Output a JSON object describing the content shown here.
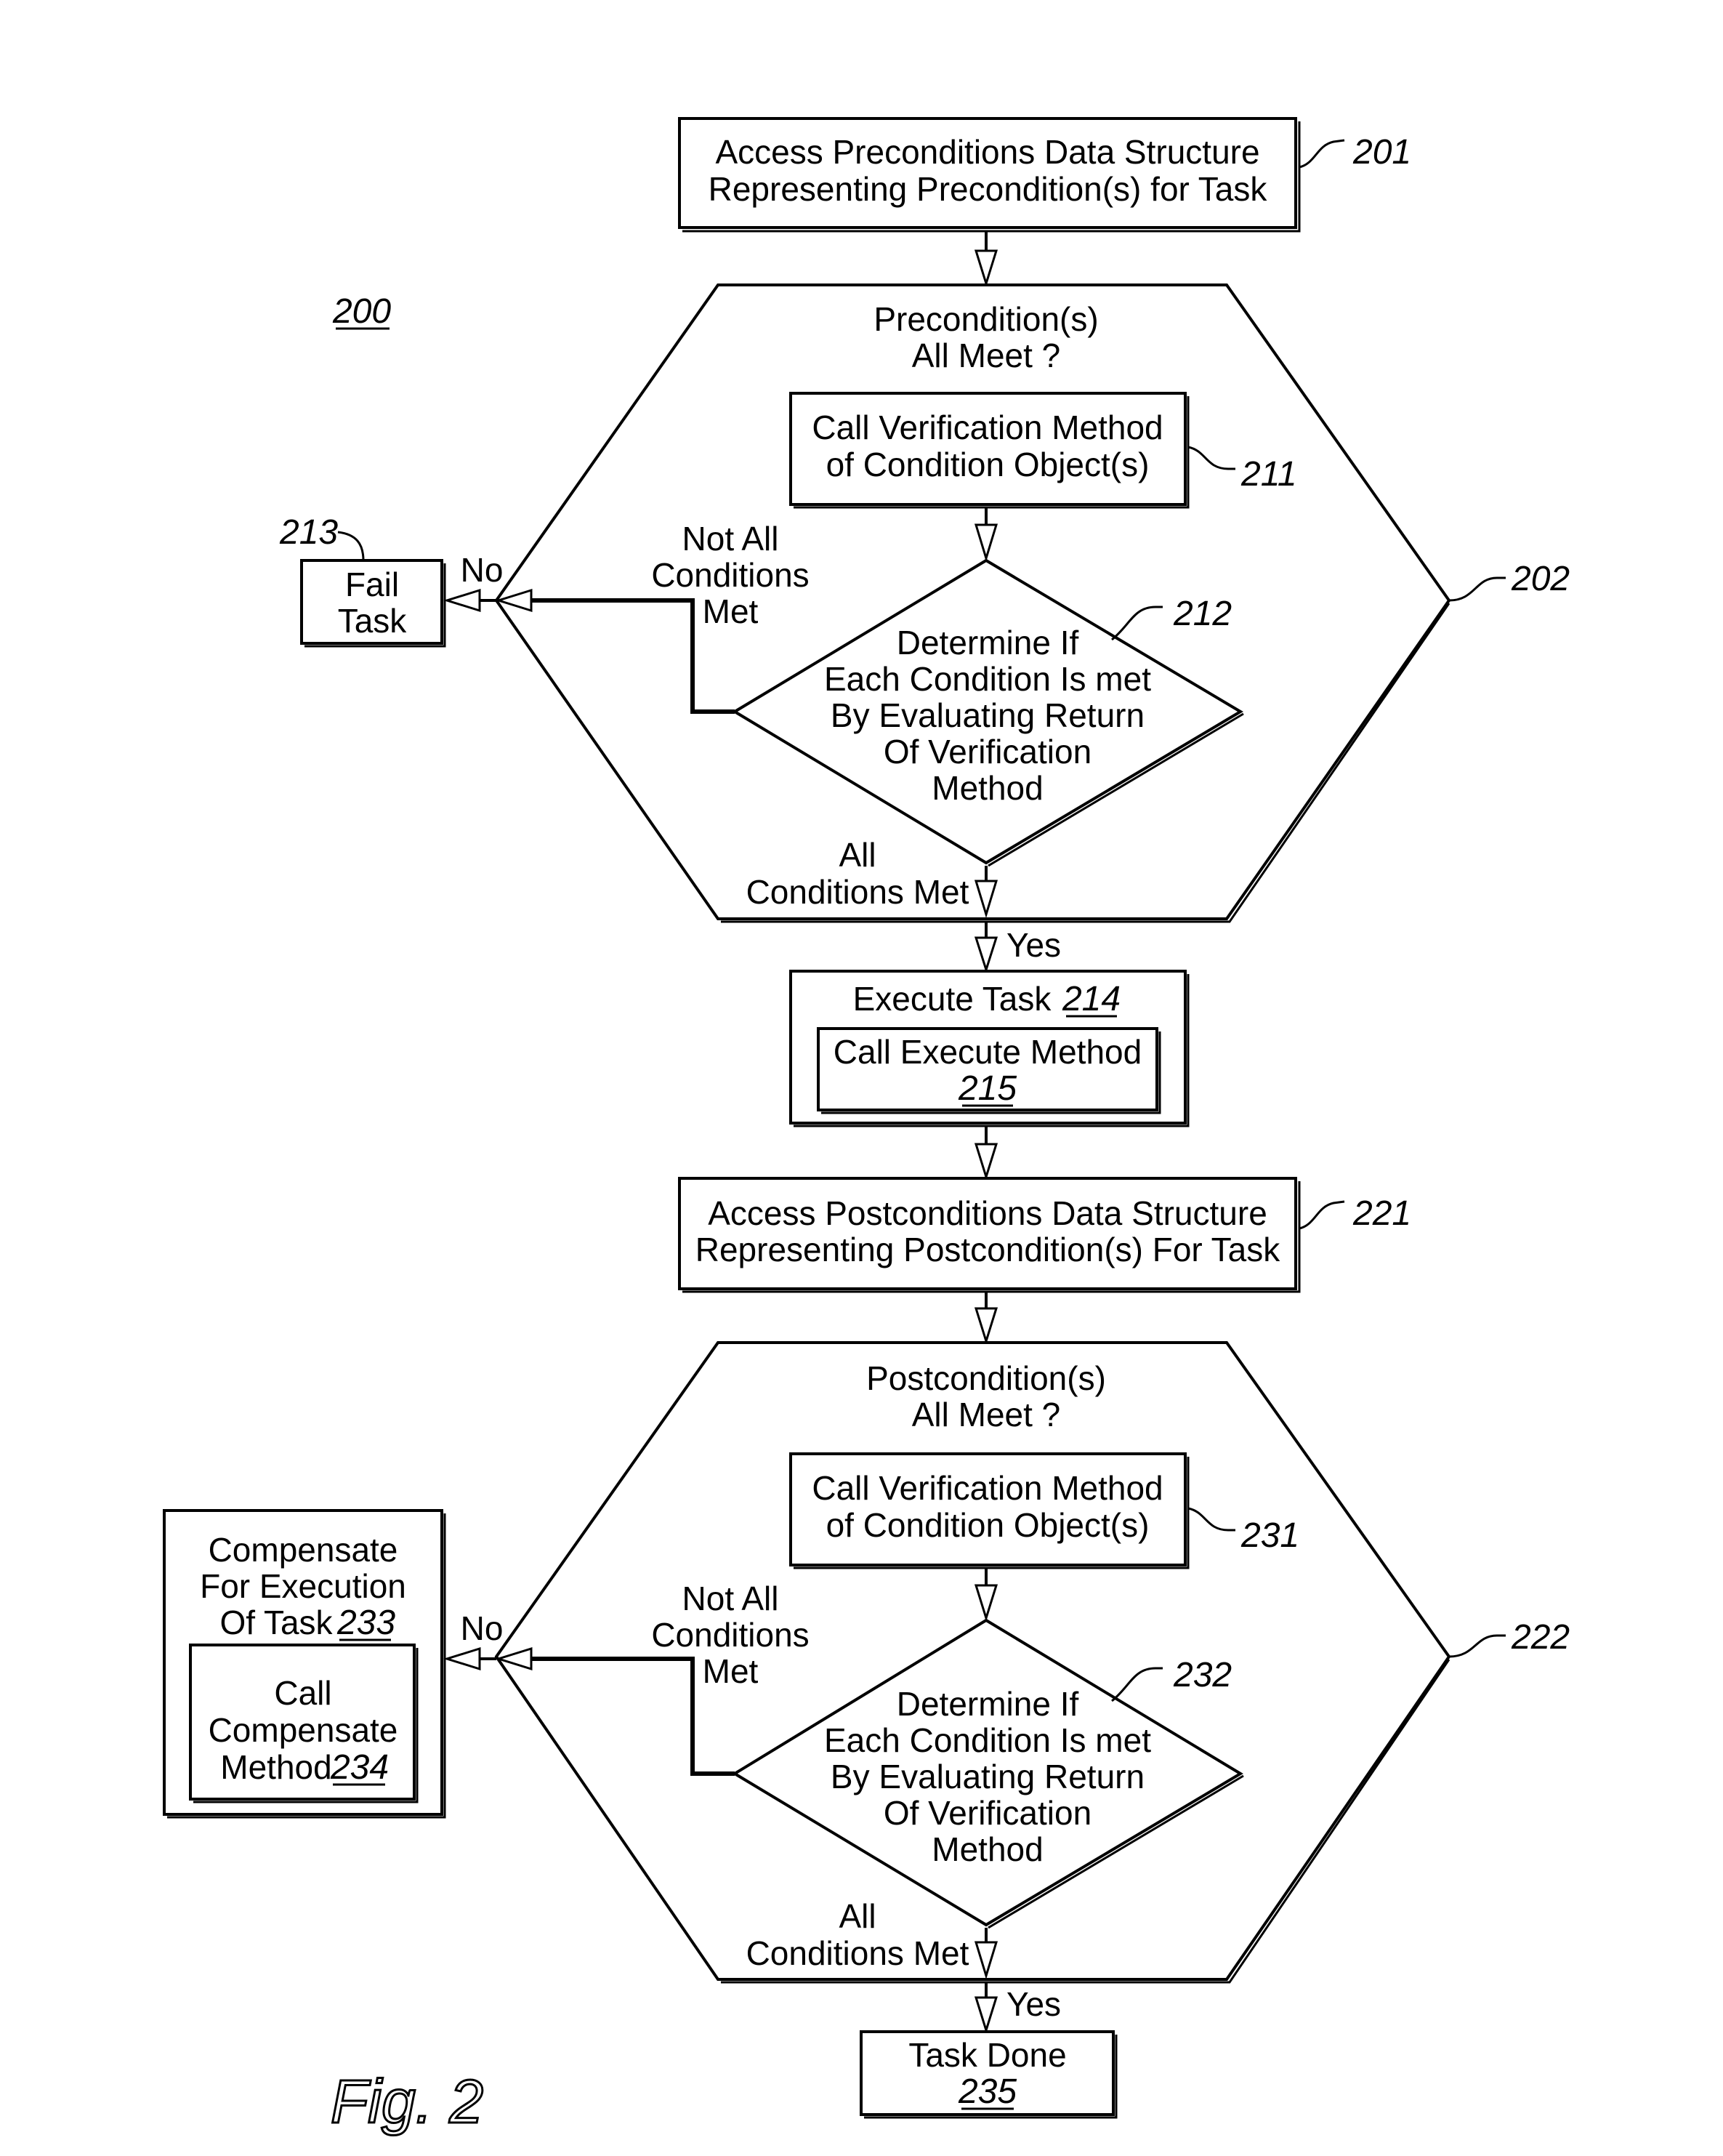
{
  "figure": {
    "number_label": "200",
    "caption": "Fig.  2"
  },
  "nodes": {
    "access_preconditions": {
      "lines": [
        "Access Preconditions Data Structure",
        "Representing Precondition(s) for Task"
      ],
      "ref": "201"
    },
    "precondition_check": {
      "lines": [
        "Precondition(s)",
        "All Meet ?"
      ],
      "ref": "202"
    },
    "call_verification_pre": {
      "lines": [
        "Call Verification Method",
        "of Condition Object(s)"
      ],
      "ref": "211"
    },
    "determine_pre": {
      "lines": [
        "Determine If",
        "Each Condition Is met",
        "By Evaluating Return",
        "Of Verification",
        "Method"
      ],
      "ref": "212"
    },
    "fail_task": {
      "lines": [
        "Fail",
        "Task"
      ],
      "ref": "213"
    },
    "execute_task": {
      "label": "Execute Task",
      "ref": "214"
    },
    "call_execute": {
      "label": "Call Execute Method",
      "ref": "215"
    },
    "access_postconditions": {
      "lines": [
        "Access Postconditions Data Structure",
        "Representing Postcondition(s) For Task"
      ],
      "ref": "221"
    },
    "postcondition_check": {
      "lines": [
        "Postcondition(s)",
        "All Meet ?"
      ],
      "ref": "222"
    },
    "call_verification_post": {
      "lines": [
        "Call Verification Method",
        "of Condition Object(s)"
      ],
      "ref": "231"
    },
    "determine_post": {
      "lines": [
        "Determine If",
        "Each Condition Is met",
        "By Evaluating Return",
        "Of Verification",
        "Method"
      ],
      "ref": "232"
    },
    "compensate": {
      "lines": [
        "Compensate",
        "For Execution",
        "Of Task"
      ],
      "ref": "233"
    },
    "call_compensate": {
      "lines": [
        "Call",
        "Compensate",
        "Method"
      ],
      "ref": "234"
    },
    "task_done": {
      "label": "Task Done",
      "ref": "235"
    }
  },
  "edges": {
    "no_label": "No",
    "yes_label": "Yes",
    "not_all_met": [
      "Not All",
      "Conditions",
      "Met"
    ],
    "all_met": [
      "All",
      "Conditions Met"
    ]
  }
}
